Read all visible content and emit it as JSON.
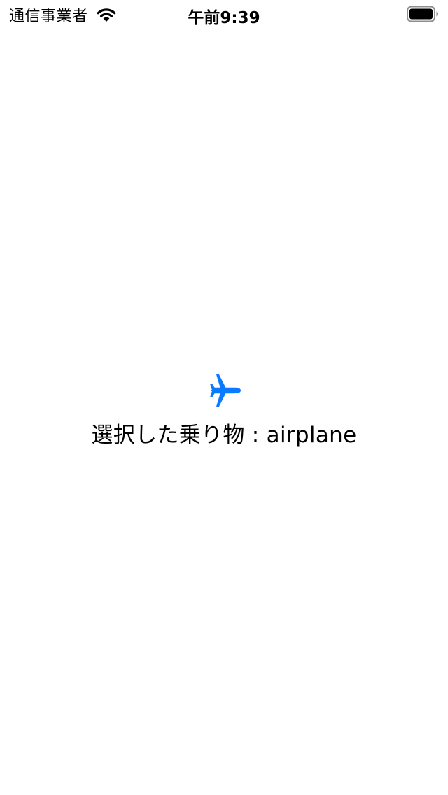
{
  "status_bar": {
    "carrier": "通信事業者",
    "time": "午前9:39",
    "wifi_icon": "wifi-icon",
    "battery_icon": "battery-full-icon",
    "battery_level": 1.0
  },
  "main": {
    "vehicle_icon": "airplane-icon",
    "accent_color": "#0A7AFF",
    "selected_label": "選択した乗り物 : airplane"
  }
}
